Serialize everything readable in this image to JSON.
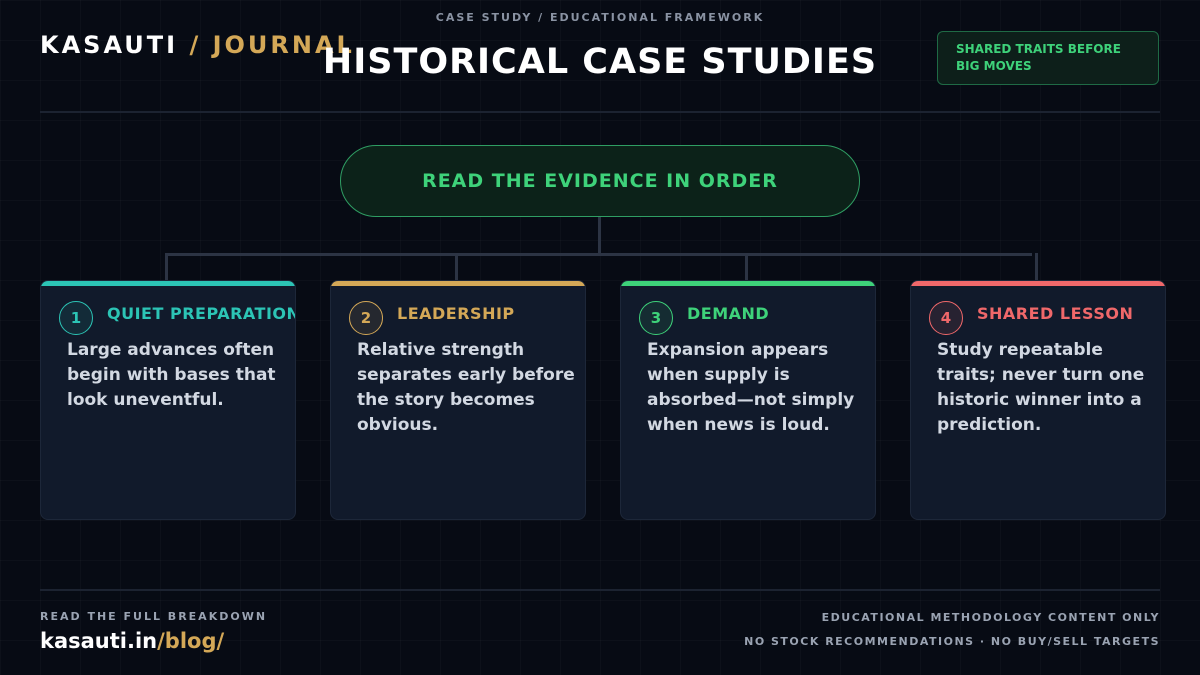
{
  "header": {
    "eyebrow": "CASE STUDY / EDUCATIONAL FRAMEWORK",
    "brand_name": "KASAUTI",
    "brand_suffix": "/ JOURNAL",
    "title": "HISTORICAL CASE STUDIES",
    "badge": "SHARED TRAITS BEFORE BIG MOVES"
  },
  "diagram": {
    "root": "READ THE EVIDENCE IN ORDER",
    "cards": [
      {
        "number": "1",
        "label": "QUIET PREPARATION",
        "body": "Large advances often begin with bases that look uneventful.",
        "color": "#2cc4b5"
      },
      {
        "number": "2",
        "label": "LEADERSHIP",
        "body": "Relative strength separates early before the story becomes obvious.",
        "color": "#d4a857"
      },
      {
        "number": "3",
        "label": "DEMAND",
        "body": "Expansion appears when supply is absorbed—not simply when news is loud.",
        "color": "#3ed27a"
      },
      {
        "number": "4",
        "label": "SHARED LESSON",
        "body": "Study repeatable traits; never turn one historic winner into a prediction.",
        "color": "#f0686a"
      }
    ]
  },
  "footer": {
    "cta": "READ THE FULL BREAKDOWN",
    "link_domain": "kasauti.in",
    "link_path": "/blog/",
    "disclaimer_1": "EDUCATIONAL METHODOLOGY CONTENT ONLY",
    "disclaimer_2": "NO STOCK RECOMMENDATIONS · NO BUY/SELL TARGETS"
  }
}
